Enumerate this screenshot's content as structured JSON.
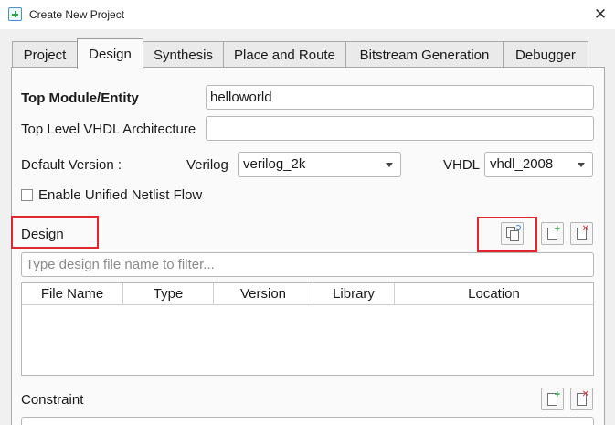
{
  "window": {
    "title": "Create New Project"
  },
  "tabs": [
    {
      "label": "Project"
    },
    {
      "label": "Design"
    },
    {
      "label": "Synthesis"
    },
    {
      "label": "Place and Route"
    },
    {
      "label": "Bitstream Generation"
    },
    {
      "label": "Debugger"
    }
  ],
  "active_tab": "Design",
  "form": {
    "top_module_label": "Top Module/Entity",
    "top_module_value": "helloworld",
    "vhdl_arch_label": "Top Level VHDL Architecture",
    "vhdl_arch_value": "",
    "default_version_label": "Default Version :",
    "verilog_label": "Verilog",
    "verilog_value": "verilog_2k",
    "vhdl_label": "VHDL",
    "vhdl_value": "vhdl_2008",
    "unified_netlist_label": "Enable Unified Netlist Flow",
    "unified_netlist_checked": false
  },
  "design": {
    "section_label": "Design",
    "filter_placeholder": "Type design file name to filter...",
    "columns": [
      "File Name",
      "Type",
      "Version",
      "Library",
      "Location"
    ],
    "rows": []
  },
  "constraint": {
    "section_label": "Constraint"
  },
  "icons": {
    "close": "close-icon",
    "add_files": "copy-files-icon",
    "new_file": "add-file-icon",
    "remove_file": "remove-file-icon"
  },
  "colors": {
    "highlight": "#e0272e",
    "add_green": "#2e9b3e",
    "remove_red": "#d8343a"
  }
}
